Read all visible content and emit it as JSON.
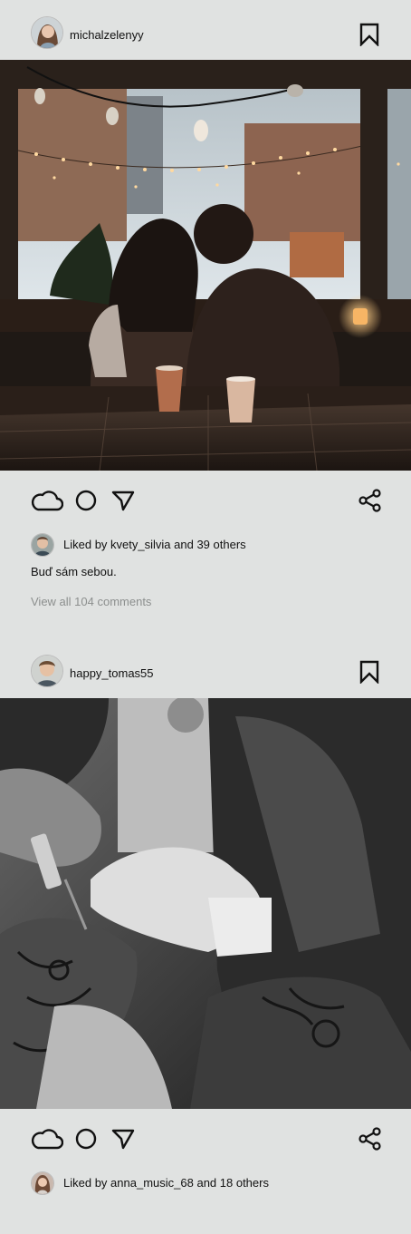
{
  "posts": [
    {
      "username": "michalzelenyy",
      "avatar_icon": "profile-photo",
      "image_description": "couple-kissing-in-cafe-window",
      "actions": [
        "cloud-icon",
        "circle-icon",
        "send-icon",
        "share-icon"
      ],
      "likes": {
        "prefix": "Liked by",
        "user": "kvety_silvia",
        "suffix": "and 39 others"
      },
      "caption": "Buď sám sebou.",
      "comments_link": "View all 104 comments"
    },
    {
      "username": "happy_tomas55",
      "avatar_icon": "profile-photo",
      "image_description": "tattoo-artist-working-black-and-white",
      "actions": [
        "cloud-icon",
        "circle-icon",
        "send-icon",
        "share-icon"
      ],
      "likes": {
        "prefix": "Liked by",
        "user": "anna_music_68",
        "suffix": "and 18 others"
      }
    }
  ],
  "colors": {
    "background": "#e0e2e1",
    "text": "#111111",
    "muted": "#8c8f8e"
  }
}
